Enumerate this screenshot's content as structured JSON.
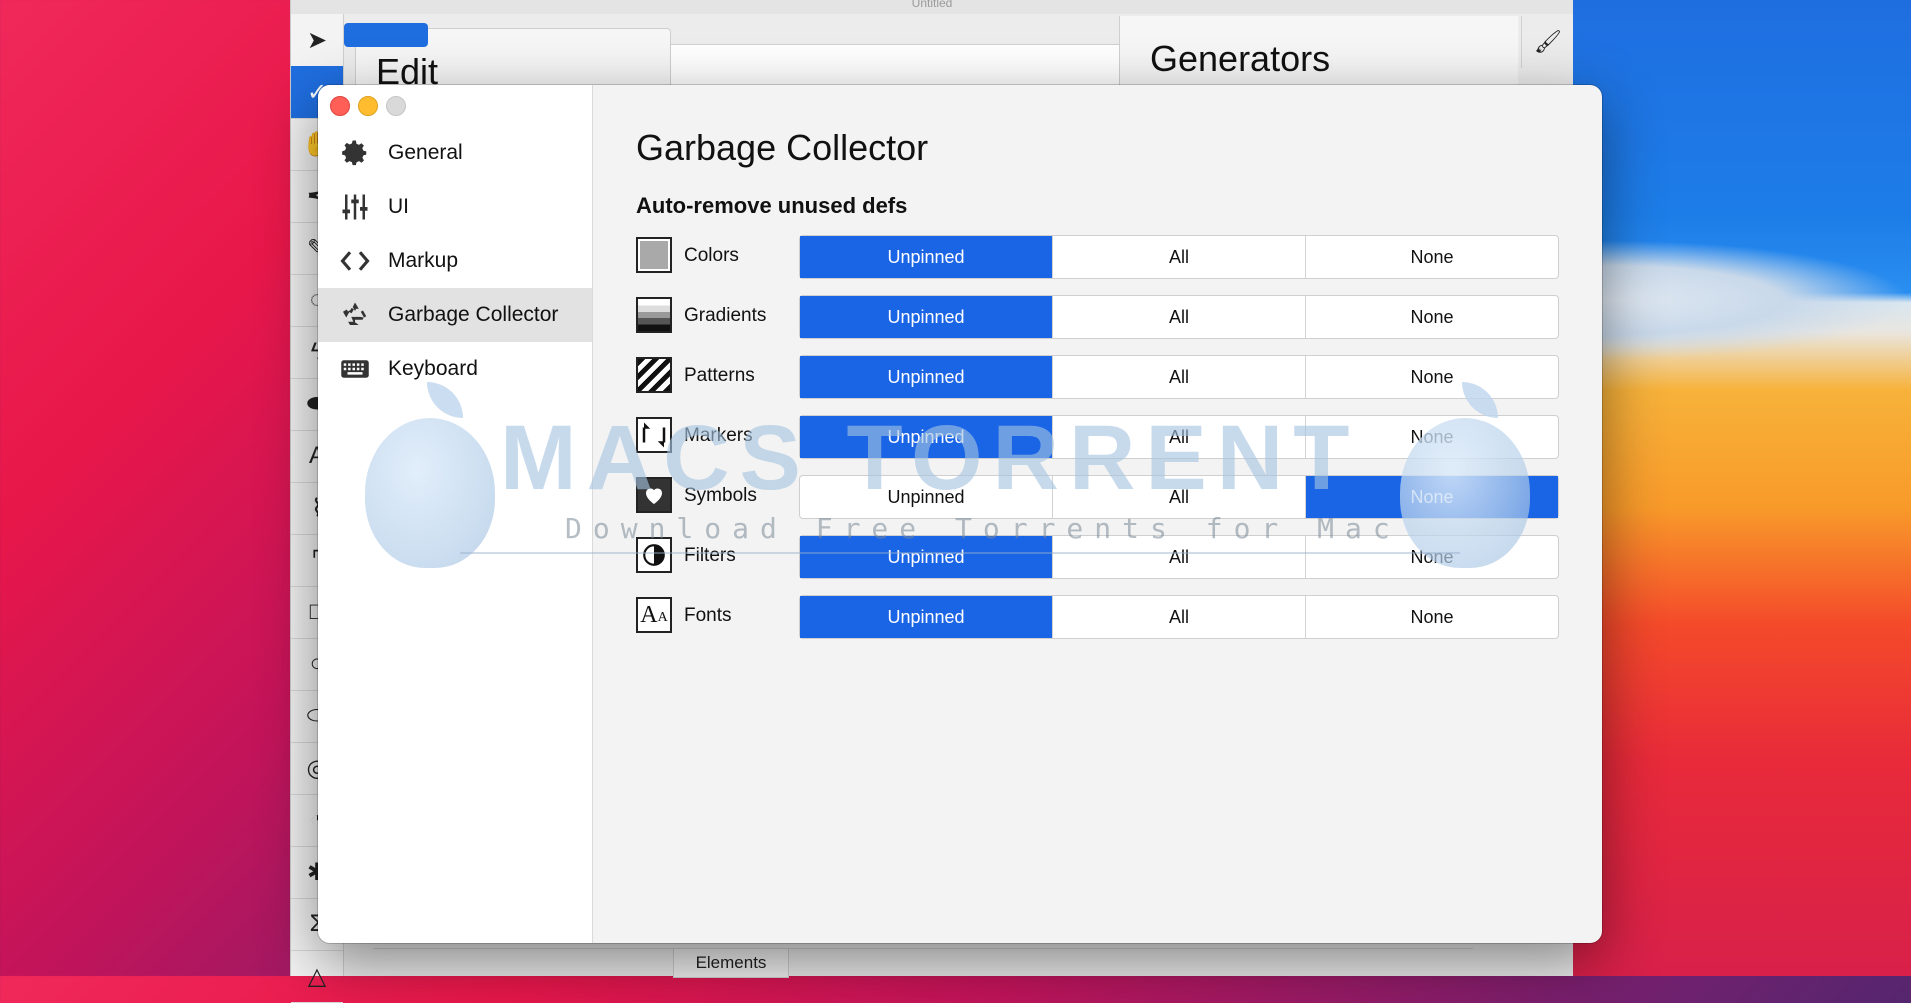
{
  "background_app": {
    "edit_title": "Edit",
    "generators_title": "Generators",
    "elements_tab": "Elements",
    "tools": [
      "arrow-icon",
      "node-icon",
      "hand-icon",
      "pen-icon",
      "pencil-icon",
      "lasso-icon",
      "spray-icon",
      "blob-icon",
      "text-icon",
      "path-text-icon",
      "frame-icon",
      "rect-icon",
      "ellipse-icon",
      "ring-icon",
      "pie-icon",
      "star-icon",
      "triangle-icon"
    ]
  },
  "prefs": {
    "sidebar": [
      {
        "label": "General",
        "icon": "gear-icon"
      },
      {
        "label": "UI",
        "icon": "sliders-icon"
      },
      {
        "label": "Markup",
        "icon": "code-icon"
      },
      {
        "label": "Garbage Collector",
        "icon": "recycle-icon"
      },
      {
        "label": "Keyboard",
        "icon": "keyboard-icon"
      }
    ],
    "selected_index": 3,
    "title": "Garbage Collector",
    "section": "Auto-remove unused defs",
    "options": [
      "Unpinned",
      "All",
      "None"
    ],
    "rows": [
      {
        "label": "Colors",
        "icon": "colors-icon",
        "selected": "Unpinned"
      },
      {
        "label": "Gradients",
        "icon": "gradients-icon",
        "selected": "Unpinned"
      },
      {
        "label": "Patterns",
        "icon": "patterns-icon",
        "selected": "Unpinned"
      },
      {
        "label": "Markers",
        "icon": "markers-icon",
        "selected": "Unpinned"
      },
      {
        "label": "Symbols",
        "icon": "symbols-icon",
        "selected": "None"
      },
      {
        "label": "Filters",
        "icon": "filters-icon",
        "selected": "Unpinned"
      },
      {
        "label": "Fonts",
        "icon": "fonts-icon",
        "selected": "Unpinned"
      }
    ],
    "accent_color": "#1a64e6"
  },
  "watermark": {
    "title": "MACS TORRENT",
    "subtitle": "Download Free Torrents for Mac"
  }
}
